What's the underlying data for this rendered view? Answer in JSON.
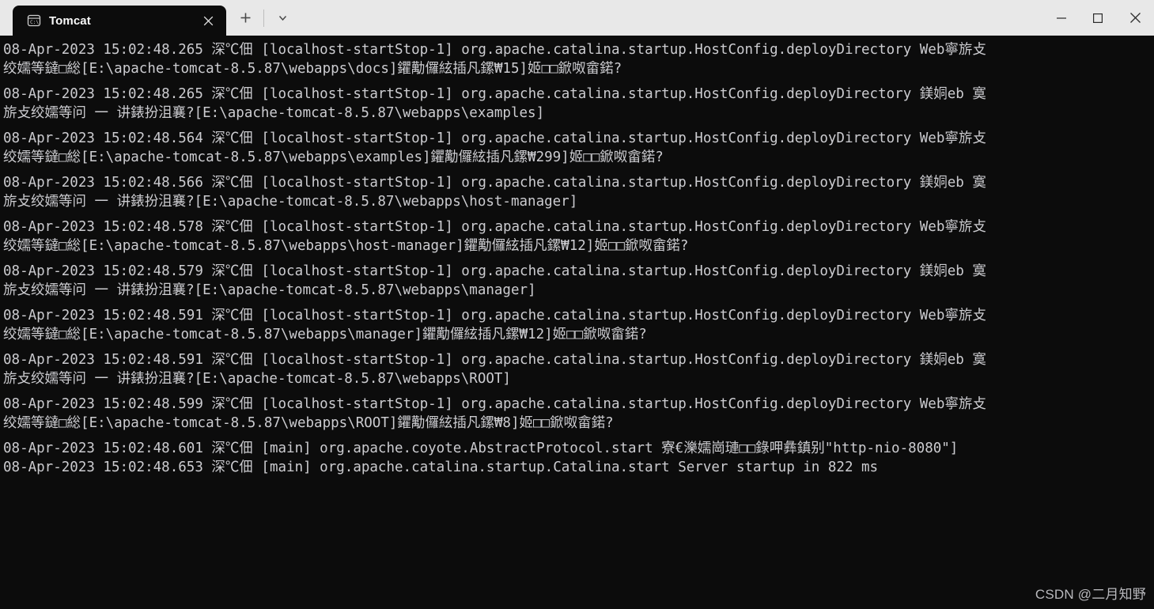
{
  "window": {
    "tab": {
      "title": "Tomcat",
      "icon": "command-prompt-icon",
      "close_label": "✕"
    },
    "new_tab_label": "+",
    "dropdown_label": "⌄",
    "controls": {
      "minimize": "—",
      "maximize": "□",
      "close": "✕"
    }
  },
  "console": {
    "background": "#0c0c0c",
    "foreground": "#ccccd0",
    "blocks": [
      {
        "lines": [
          "08-Apr-2023 15:02:48.265 深℃佃 [localhost-startStop-1] org.apache.catalina.startup.HostConfig.deployDirectory Web寧旂攴",
          "绞嬬等鐽□総[E:\\apache-tomcat-8.5.87\\webapps\\docs]鑺勱儸絃插凡鏍₩15]姬□□鍁呶畲鍩?"
        ]
      },
      {
        "lines": [
          "08-Apr-2023 15:02:48.265 深℃佃 [localhost-startStop-1] org.apache.catalina.startup.HostConfig.deployDirectory 鎂姛eb 寞",
          "旂攴绞嬬等问 一 讲錶扮沮襄?[E:\\apache-tomcat-8.5.87\\webapps\\examples]"
        ]
      },
      {
        "lines": [
          "08-Apr-2023 15:02:48.564 深℃佃 [localhost-startStop-1] org.apache.catalina.startup.HostConfig.deployDirectory Web寧旂攴",
          "绞嬬等鐽□総[E:\\apache-tomcat-8.5.87\\webapps\\examples]鑺勱儸絃插凡鏍₩299]姬□□鍁呶畲鍩?"
        ]
      },
      {
        "lines": [
          "08-Apr-2023 15:02:48.566 深℃佃 [localhost-startStop-1] org.apache.catalina.startup.HostConfig.deployDirectory 鎂姛eb 寞",
          "旂攴绞嬬等问 一 讲錶扮沮襄?[E:\\apache-tomcat-8.5.87\\webapps\\host-manager]"
        ]
      },
      {
        "lines": [
          "08-Apr-2023 15:02:48.578 深℃佃 [localhost-startStop-1] org.apache.catalina.startup.HostConfig.deployDirectory Web寧旂攴",
          "绞嬬等鐽□総[E:\\apache-tomcat-8.5.87\\webapps\\host-manager]鑺勱儸絃插凡鏍₩12]姬□□鍁呶畲鍩?"
        ]
      },
      {
        "lines": [
          "08-Apr-2023 15:02:48.579 深℃佃 [localhost-startStop-1] org.apache.catalina.startup.HostConfig.deployDirectory 鎂姛eb 寞",
          "旂攴绞嬬等问 一 讲錶扮沮襄?[E:\\apache-tomcat-8.5.87\\webapps\\manager]"
        ]
      },
      {
        "lines": [
          "08-Apr-2023 15:02:48.591 深℃佃 [localhost-startStop-1] org.apache.catalina.startup.HostConfig.deployDirectory Web寧旂攴",
          "绞嬬等鐽□総[E:\\apache-tomcat-8.5.87\\webapps\\manager]鑺勱儸絃插凡鏍₩12]姬□□鍁呶畲鍩?"
        ]
      },
      {
        "lines": [
          "08-Apr-2023 15:02:48.591 深℃佃 [localhost-startStop-1] org.apache.catalina.startup.HostConfig.deployDirectory 鎂姛eb 寞",
          "旂攴绞嬬等问 一 讲錶扮沮襄?[E:\\apache-tomcat-8.5.87\\webapps\\ROOT]"
        ]
      },
      {
        "lines": [
          "08-Apr-2023 15:02:48.599 深℃佃 [localhost-startStop-1] org.apache.catalina.startup.HostConfig.deployDirectory Web寧旂攴",
          "绞嬬等鐽□総[E:\\apache-tomcat-8.5.87\\webapps\\ROOT]鑺勱儸絃插凡鏍₩8]姬□□鍁呶畲鍩?"
        ]
      },
      {
        "lines": [
          "08-Apr-2023 15:02:48.601 深℃佃 [main] org.apache.coyote.AbstractProtocol.start 寮€濼嬬崗璉□□錄呷彝鎮别\"http-nio-8080\"]"
        ]
      },
      {
        "lines": [
          "08-Apr-2023 15:02:48.653 深℃佃 [main] org.apache.catalina.startup.Catalina.start Server startup in 822 ms"
        ]
      }
    ]
  },
  "watermark": {
    "text": "CSDN @二月知野"
  }
}
